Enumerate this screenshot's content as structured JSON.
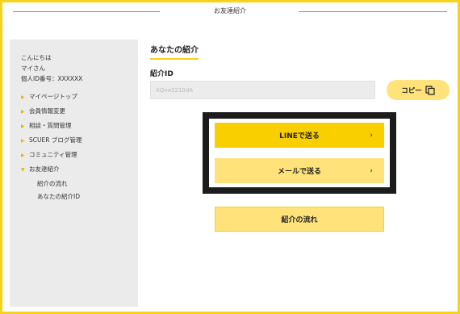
{
  "header": {
    "title": "お友達紹介"
  },
  "sidebar": {
    "greeting": [
      "こんにちは",
      "マイさん",
      "個人ID番号：XXXXXX"
    ],
    "menu": [
      {
        "label": "マイページトップ"
      },
      {
        "label": "会員情報変更"
      },
      {
        "label": "相談・質問管理"
      },
      {
        "label": "SCUER ブログ管理"
      },
      {
        "label": "コミュニティ管理"
      },
      {
        "label": "お友達紹介"
      }
    ],
    "submenu": [
      {
        "label": "紹介の流れ"
      },
      {
        "label": "あなたの紹介ID"
      }
    ]
  },
  "main": {
    "section_title": "あなたの紹介",
    "id_label": "紹介ID",
    "id_value": "XQna3210dA",
    "copy_label": "コピー",
    "line_button": "LINEで送る",
    "mail_button": "メールで送る",
    "chevron": "›",
    "flow_button": "紹介の流れ"
  },
  "colors": {
    "accent": "#f7d21a",
    "button_primary": "#f9cf00",
    "button_secondary": "#ffe27a"
  }
}
